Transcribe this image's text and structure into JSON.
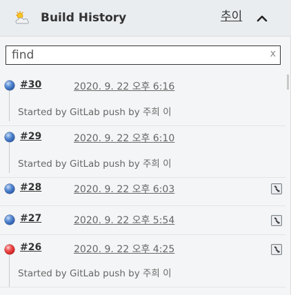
{
  "header": {
    "title": "Build History",
    "trend_label": "추이",
    "weather_icon": "partly-sunny-icon",
    "collapse_icon": "chevron-up-icon"
  },
  "search": {
    "value": "",
    "placeholder": "find",
    "clear_label": "x"
  },
  "colors": {
    "success": "#2a5aa8",
    "failure": "#cc1f1f"
  },
  "builds": [
    {
      "number": "#30",
      "time": "2020. 9. 22 오후 6:16",
      "status": "blue",
      "cause": "Started by GitLab push by 주희 이",
      "has_console": false
    },
    {
      "number": "#29",
      "time": "2020. 9. 22 오후 6:10",
      "status": "blue",
      "cause": "Started by GitLab push by 주희 이",
      "has_console": false
    },
    {
      "number": "#28",
      "time": "2020. 9. 22 오후 6:03",
      "status": "blue",
      "cause": "",
      "has_console": true
    },
    {
      "number": "#27",
      "time": "2020. 9. 22 오후 5:54",
      "status": "blue",
      "cause": "",
      "has_console": true
    },
    {
      "number": "#26",
      "time": "2020. 9. 22 오후 4:25",
      "status": "red",
      "cause": "Started by GitLab push by 주희 이",
      "has_console": true
    }
  ]
}
